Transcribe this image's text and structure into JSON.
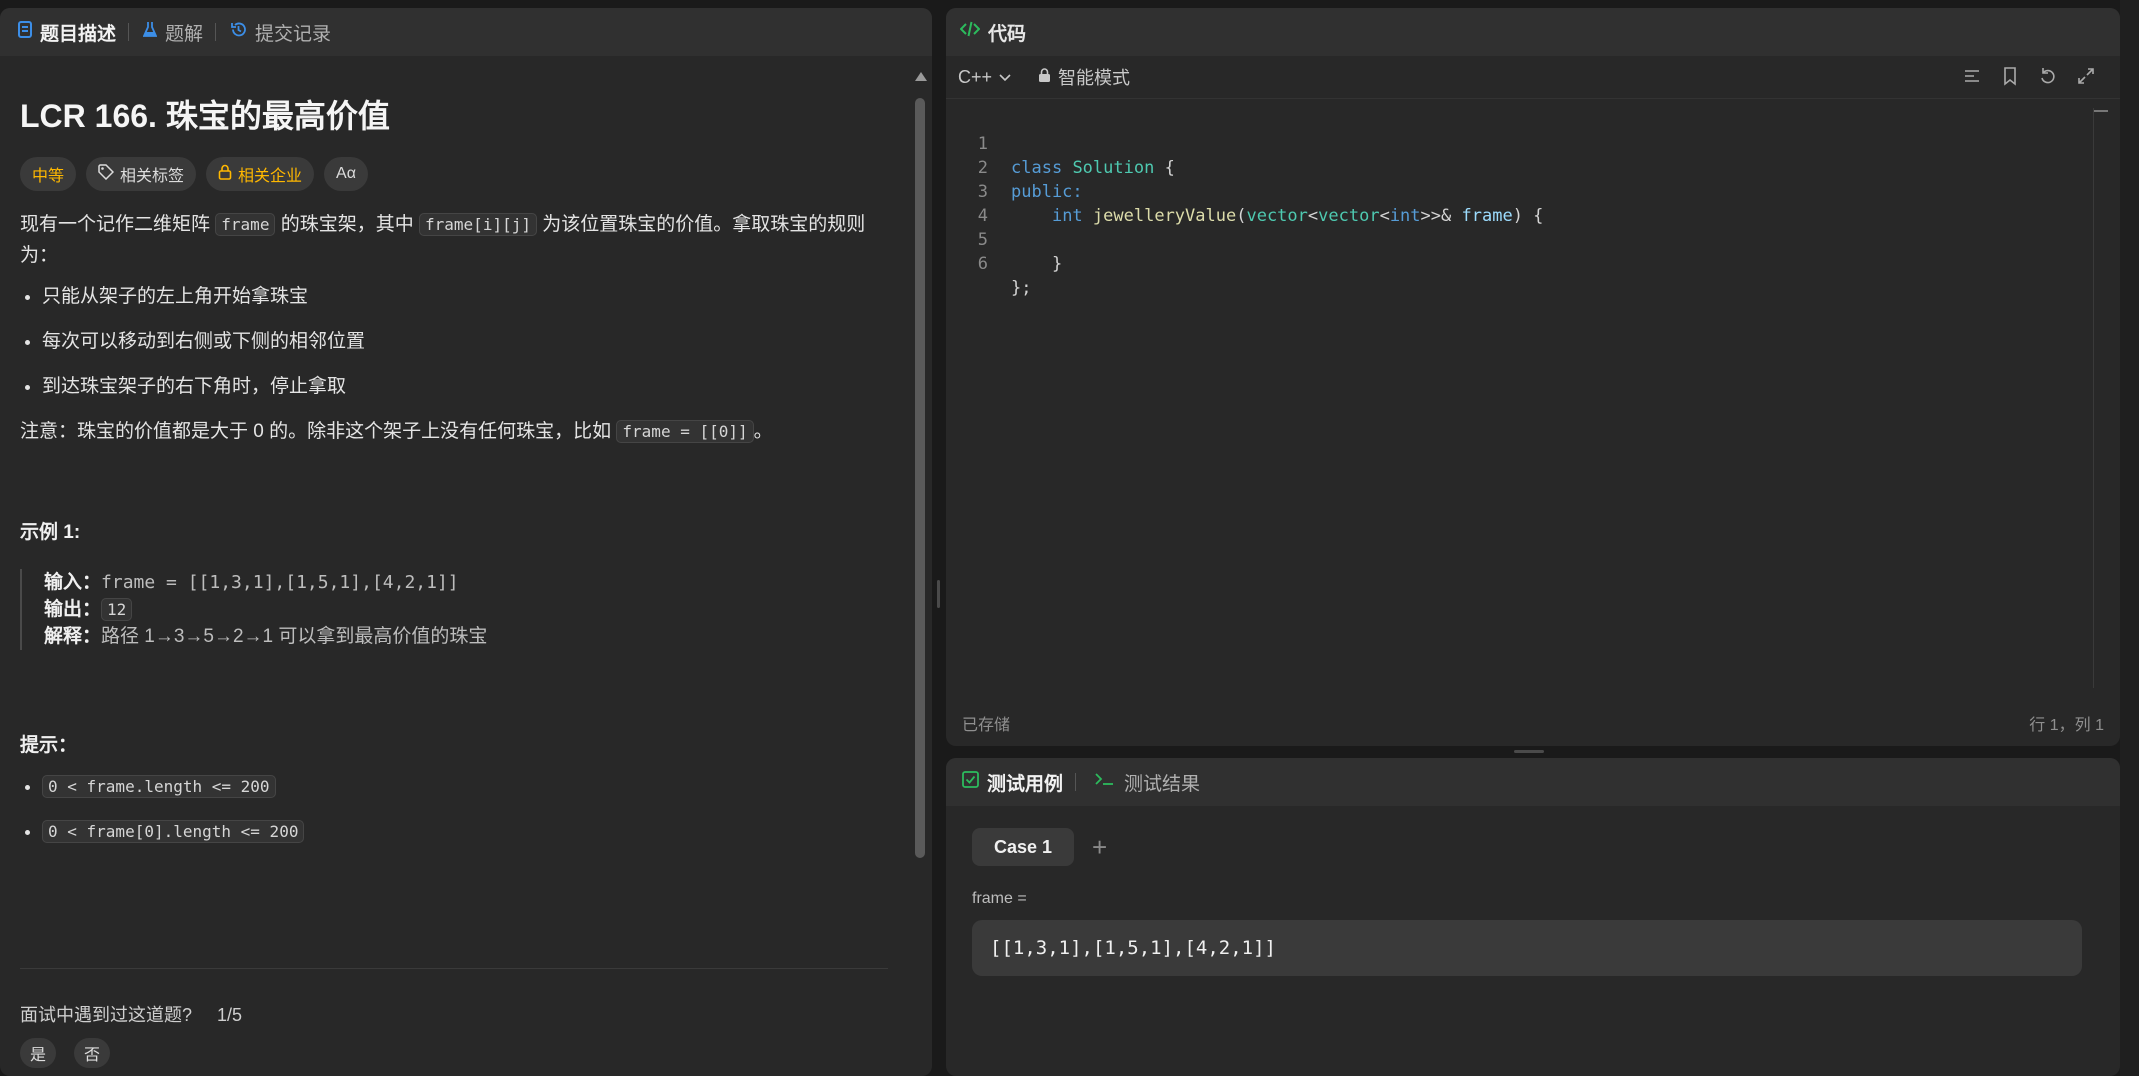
{
  "left_tabs": [
    {
      "label": "题目描述",
      "icon": "description-icon"
    },
    {
      "label": "题解",
      "icon": "flask-icon"
    },
    {
      "label": "提交记录",
      "icon": "history-icon"
    }
  ],
  "problem": {
    "title": "LCR 166. 珠宝的最高价值",
    "tags": {
      "difficulty": "中等",
      "related_tags": "相关标签",
      "related_companies": "相关企业",
      "font_toggle": "Aα"
    },
    "desc_part1": "现有一个记作二维矩阵 ",
    "desc_code1": "frame",
    "desc_part2": " 的珠宝架，其中 ",
    "desc_code2": "frame[i][j]",
    "desc_part3": " 为该位置珠宝的价值。拿取珠宝的规则为：",
    "rules": [
      "只能从架子的左上角开始拿珠宝",
      "每次可以移动到右侧或下侧的相邻位置",
      "到达珠宝架子的右下角时，停止拿取"
    ],
    "note_part1": "注意：珠宝的价值都是大于 0 的。除非这个架子上没有任何珠宝，比如 ",
    "note_code": "frame = [[0]]",
    "note_part2": "。",
    "example_heading": "示例 1:",
    "example_input_label": "输入：",
    "example_input": "frame = [[1,3,1],[1,5,1],[4,2,1]]",
    "example_output_label": "输出：",
    "example_output": "12",
    "example_explain_label": "解释：",
    "example_explain": "路径 1→3→5→2→1 可以拿到最高价值的珠宝",
    "hint_heading": "提示：",
    "hints": [
      "0 < frame.length <= 200",
      "0 < frame[0].length <= 200"
    ],
    "faced_question": "面试中遇到过这道题?",
    "faced_count": "1/5",
    "yes": "是",
    "no": "否"
  },
  "editor": {
    "title": "代码",
    "language": "C++",
    "mode": "智能模式",
    "lines": [
      "1",
      "2",
      "3",
      "4",
      "5",
      "6"
    ],
    "code": {
      "l1_kw": "class",
      "l1_name": "Solution",
      "l1_rest": " {",
      "l2": "public:",
      "l3_kw": "int",
      "l3_fn": "jewelleryValue",
      "l3_p1": "(",
      "l3_t1": "vector",
      "l3_lt1": "<",
      "l3_t2": "vector",
      "l3_lt2": "<",
      "l3_t3": "int",
      "l3_gt": ">>&",
      "l3_param": "frame",
      "l3_end": ") {",
      "l5": "}",
      "l6": "};"
    },
    "saved": "已存储",
    "cursor": "行 1，列 1"
  },
  "tests": {
    "tab_cases": "测试用例",
    "tab_results": "测试结果",
    "case_label": "Case 1",
    "var_name": "frame =",
    "var_value": "[[1,3,1],[1,5,1],[4,2,1]]"
  },
  "colors": {
    "accent_green": "#2cbb5d",
    "difficulty": "#ffb800",
    "blue_icon": "#3c8ee7"
  }
}
